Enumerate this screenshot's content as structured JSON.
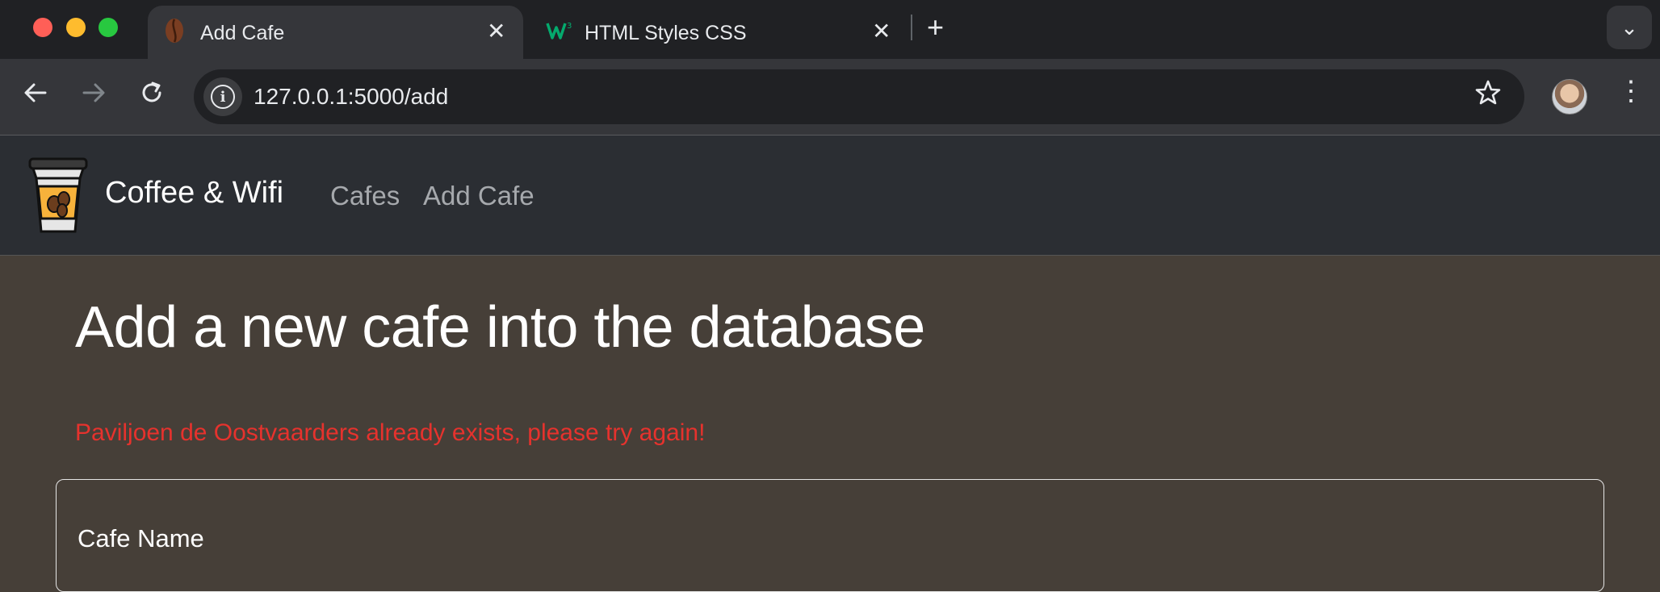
{
  "browser": {
    "tabs": [
      {
        "title": "Add Cafe",
        "active": true,
        "favicon": "coffee-bean-icon"
      },
      {
        "title": "HTML Styles CSS",
        "active": false,
        "favicon": "w3schools-icon"
      }
    ],
    "address": "127.0.0.1:5000/add",
    "traffic_lights": {
      "close": "#ff5f57",
      "minimize": "#febc2e",
      "zoom": "#28c840"
    }
  },
  "site": {
    "brand": "Coffee & Wifi",
    "nav": [
      "Cafes",
      "Add Cafe"
    ]
  },
  "page": {
    "title": "Add a new cafe into the database",
    "error": "Paviljoen de Oostvaarders already exists, please try again!",
    "form": {
      "cafe_name_label": "Cafe Name"
    }
  },
  "colors": {
    "page_bg": "#463f38",
    "navbar_bg": "#2b2e33",
    "error": "#e6322d"
  }
}
